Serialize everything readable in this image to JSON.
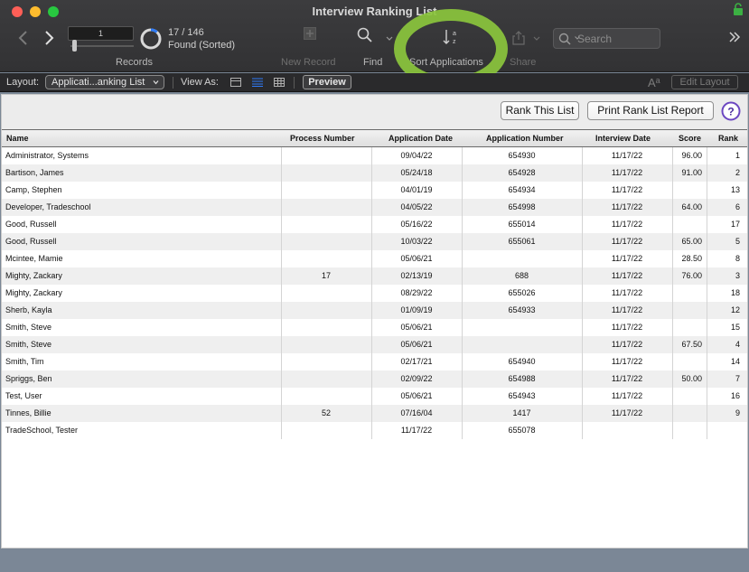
{
  "window": {
    "title": "Interview Ranking List"
  },
  "toolbar": {
    "record_number": "1",
    "found_count": "17 / 146",
    "found_status": "Found (Sorted)",
    "found_fraction": 0.116,
    "records_label": "Records",
    "new_record_label": "New Record",
    "find_label": "Find",
    "sort_label": "Sort Applications",
    "share_label": "Share",
    "search_placeholder": "Search"
  },
  "layout_bar": {
    "layout_label": "Layout:",
    "layout_value": "Applicati...anking List",
    "view_as_label": "View As:",
    "preview_label": "Preview",
    "edit_layout_label": "Edit Layout"
  },
  "actions": {
    "rank_this_list": "Rank This List",
    "print_report": "Print Rank List Report"
  },
  "table": {
    "headers": {
      "name": "Name",
      "process": "Process Number",
      "app_date": "Application Date",
      "app_num": "Application Number",
      "interview": "Interview Date",
      "score": "Score",
      "rank": "Rank"
    },
    "rows": [
      {
        "name": "Administrator, Systems",
        "process": "",
        "app_date": "09/04/22",
        "app_num": "654930",
        "interview": "11/17/22",
        "score": "96.00",
        "rank": "1"
      },
      {
        "name": "Bartison, James",
        "process": "",
        "app_date": "05/24/18",
        "app_num": "654928",
        "interview": "11/17/22",
        "score": "91.00",
        "rank": "2"
      },
      {
        "name": "Camp, Stephen",
        "process": "",
        "app_date": "04/01/19",
        "app_num": "654934",
        "interview": "11/17/22",
        "score": "",
        "rank": "13"
      },
      {
        "name": "Developer, Tradeschool",
        "process": "",
        "app_date": "04/05/22",
        "app_num": "654998",
        "interview": "11/17/22",
        "score": "64.00",
        "rank": "6"
      },
      {
        "name": "Good, Russell",
        "process": "",
        "app_date": "05/16/22",
        "app_num": "655014",
        "interview": "11/17/22",
        "score": "",
        "rank": "17"
      },
      {
        "name": "Good, Russell",
        "process": "",
        "app_date": "10/03/22",
        "app_num": "655061",
        "interview": "11/17/22",
        "score": "65.00",
        "rank": "5"
      },
      {
        "name": "Mcintee, Mamie",
        "process": "",
        "app_date": "05/06/21",
        "app_num": "",
        "interview": "11/17/22",
        "score": "28.50",
        "rank": "8"
      },
      {
        "name": "Mighty, Zackary",
        "process": "17",
        "app_date": "02/13/19",
        "app_num": "688",
        "interview": "11/17/22",
        "score": "76.00",
        "rank": "3"
      },
      {
        "name": "Mighty, Zackary",
        "process": "",
        "app_date": "08/29/22",
        "app_num": "655026",
        "interview": "11/17/22",
        "score": "",
        "rank": "18"
      },
      {
        "name": "Sherb, Kayla",
        "process": "",
        "app_date": "01/09/19",
        "app_num": "654933",
        "interview": "11/17/22",
        "score": "",
        "rank": "12"
      },
      {
        "name": "Smith, Steve",
        "process": "",
        "app_date": "05/06/21",
        "app_num": "",
        "interview": "11/17/22",
        "score": "",
        "rank": "15"
      },
      {
        "name": "Smith, Steve",
        "process": "",
        "app_date": "05/06/21",
        "app_num": "",
        "interview": "11/17/22",
        "score": "67.50",
        "rank": "4"
      },
      {
        "name": "Smith, Tim",
        "process": "",
        "app_date": "02/17/21",
        "app_num": "654940",
        "interview": "11/17/22",
        "score": "",
        "rank": "14"
      },
      {
        "name": "Spriggs, Ben",
        "process": "",
        "app_date": "02/09/22",
        "app_num": "654988",
        "interview": "11/17/22",
        "score": "50.00",
        "rank": "7"
      },
      {
        "name": "Test, User",
        "process": "",
        "app_date": "05/06/21",
        "app_num": "654943",
        "interview": "11/17/22",
        "score": "",
        "rank": "16"
      },
      {
        "name": "Tinnes, Billie",
        "process": "52",
        "app_date": "07/16/04",
        "app_num": "1417",
        "interview": "11/17/22",
        "score": "",
        "rank": "9"
      },
      {
        "name": "TradeSchool, Tester",
        "process": "",
        "app_date": "11/17/22",
        "app_num": "655078",
        "interview": "",
        "score": "",
        "rank": ""
      }
    ]
  },
  "colors": {
    "highlight_ring": "#8bc53d",
    "pie_accent": "#2f7bf6"
  }
}
